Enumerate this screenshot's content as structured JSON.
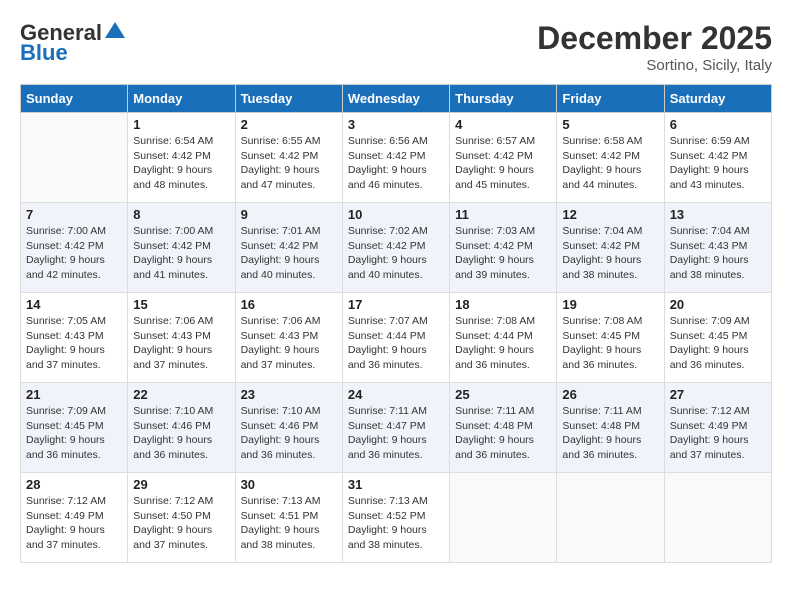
{
  "header": {
    "logo_line1": "General",
    "logo_line2": "Blue",
    "month": "December 2025",
    "location": "Sortino, Sicily, Italy"
  },
  "days_of_week": [
    "Sunday",
    "Monday",
    "Tuesday",
    "Wednesday",
    "Thursday",
    "Friday",
    "Saturday"
  ],
  "weeks": [
    [
      {
        "day": "",
        "sunrise": "",
        "sunset": "",
        "daylight": ""
      },
      {
        "day": "1",
        "sunrise": "6:54 AM",
        "sunset": "4:42 PM",
        "daylight": "9 hours and 48 minutes."
      },
      {
        "day": "2",
        "sunrise": "6:55 AM",
        "sunset": "4:42 PM",
        "daylight": "9 hours and 47 minutes."
      },
      {
        "day": "3",
        "sunrise": "6:56 AM",
        "sunset": "4:42 PM",
        "daylight": "9 hours and 46 minutes."
      },
      {
        "day": "4",
        "sunrise": "6:57 AM",
        "sunset": "4:42 PM",
        "daylight": "9 hours and 45 minutes."
      },
      {
        "day": "5",
        "sunrise": "6:58 AM",
        "sunset": "4:42 PM",
        "daylight": "9 hours and 44 minutes."
      },
      {
        "day": "6",
        "sunrise": "6:59 AM",
        "sunset": "4:42 PM",
        "daylight": "9 hours and 43 minutes."
      }
    ],
    [
      {
        "day": "7",
        "sunrise": "7:00 AM",
        "sunset": "4:42 PM",
        "daylight": "9 hours and 42 minutes."
      },
      {
        "day": "8",
        "sunrise": "7:00 AM",
        "sunset": "4:42 PM",
        "daylight": "9 hours and 41 minutes."
      },
      {
        "day": "9",
        "sunrise": "7:01 AM",
        "sunset": "4:42 PM",
        "daylight": "9 hours and 40 minutes."
      },
      {
        "day": "10",
        "sunrise": "7:02 AM",
        "sunset": "4:42 PM",
        "daylight": "9 hours and 40 minutes."
      },
      {
        "day": "11",
        "sunrise": "7:03 AM",
        "sunset": "4:42 PM",
        "daylight": "9 hours and 39 minutes."
      },
      {
        "day": "12",
        "sunrise": "7:04 AM",
        "sunset": "4:42 PM",
        "daylight": "9 hours and 38 minutes."
      },
      {
        "day": "13",
        "sunrise": "7:04 AM",
        "sunset": "4:43 PM",
        "daylight": "9 hours and 38 minutes."
      }
    ],
    [
      {
        "day": "14",
        "sunrise": "7:05 AM",
        "sunset": "4:43 PM",
        "daylight": "9 hours and 37 minutes."
      },
      {
        "day": "15",
        "sunrise": "7:06 AM",
        "sunset": "4:43 PM",
        "daylight": "9 hours and 37 minutes."
      },
      {
        "day": "16",
        "sunrise": "7:06 AM",
        "sunset": "4:43 PM",
        "daylight": "9 hours and 37 minutes."
      },
      {
        "day": "17",
        "sunrise": "7:07 AM",
        "sunset": "4:44 PM",
        "daylight": "9 hours and 36 minutes."
      },
      {
        "day": "18",
        "sunrise": "7:08 AM",
        "sunset": "4:44 PM",
        "daylight": "9 hours and 36 minutes."
      },
      {
        "day": "19",
        "sunrise": "7:08 AM",
        "sunset": "4:45 PM",
        "daylight": "9 hours and 36 minutes."
      },
      {
        "day": "20",
        "sunrise": "7:09 AM",
        "sunset": "4:45 PM",
        "daylight": "9 hours and 36 minutes."
      }
    ],
    [
      {
        "day": "21",
        "sunrise": "7:09 AM",
        "sunset": "4:45 PM",
        "daylight": "9 hours and 36 minutes."
      },
      {
        "day": "22",
        "sunrise": "7:10 AM",
        "sunset": "4:46 PM",
        "daylight": "9 hours and 36 minutes."
      },
      {
        "day": "23",
        "sunrise": "7:10 AM",
        "sunset": "4:46 PM",
        "daylight": "9 hours and 36 minutes."
      },
      {
        "day": "24",
        "sunrise": "7:11 AM",
        "sunset": "4:47 PM",
        "daylight": "9 hours and 36 minutes."
      },
      {
        "day": "25",
        "sunrise": "7:11 AM",
        "sunset": "4:48 PM",
        "daylight": "9 hours and 36 minutes."
      },
      {
        "day": "26",
        "sunrise": "7:11 AM",
        "sunset": "4:48 PM",
        "daylight": "9 hours and 36 minutes."
      },
      {
        "day": "27",
        "sunrise": "7:12 AM",
        "sunset": "4:49 PM",
        "daylight": "9 hours and 37 minutes."
      }
    ],
    [
      {
        "day": "28",
        "sunrise": "7:12 AM",
        "sunset": "4:49 PM",
        "daylight": "9 hours and 37 minutes."
      },
      {
        "day": "29",
        "sunrise": "7:12 AM",
        "sunset": "4:50 PM",
        "daylight": "9 hours and 37 minutes."
      },
      {
        "day": "30",
        "sunrise": "7:13 AM",
        "sunset": "4:51 PM",
        "daylight": "9 hours and 38 minutes."
      },
      {
        "day": "31",
        "sunrise": "7:13 AM",
        "sunset": "4:52 PM",
        "daylight": "9 hours and 38 minutes."
      },
      {
        "day": "",
        "sunrise": "",
        "sunset": "",
        "daylight": ""
      },
      {
        "day": "",
        "sunrise": "",
        "sunset": "",
        "daylight": ""
      },
      {
        "day": "",
        "sunrise": "",
        "sunset": "",
        "daylight": ""
      }
    ]
  ],
  "labels": {
    "sunrise": "Sunrise:",
    "sunset": "Sunset:",
    "daylight": "Daylight:"
  }
}
